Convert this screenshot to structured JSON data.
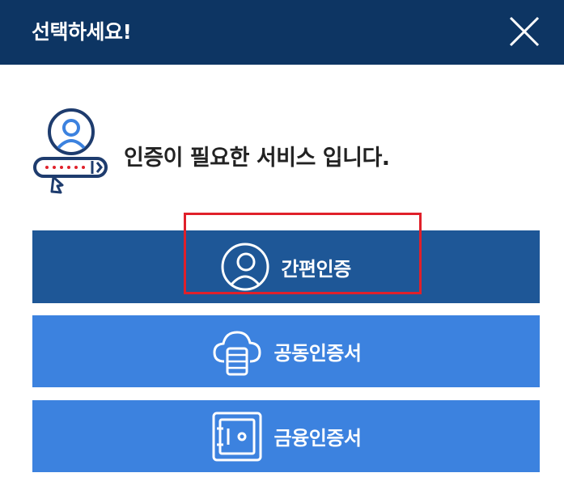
{
  "header": {
    "title": "선택하세요!",
    "close_icon": "close-x-icon"
  },
  "auth_notice": {
    "icon": "user-password-icon",
    "message": "인증이 필요한 서비스 입니다."
  },
  "buttons": [
    {
      "label": "간편인증",
      "icon": "user-circle-icon"
    },
    {
      "label": "공동인증서",
      "icon": "cloud-database-icon"
    },
    {
      "label": "금융인증서",
      "icon": "safe-vault-icon"
    }
  ],
  "colors": {
    "header_bg": "#0d3563",
    "simple_auth_bg": "#1e5797",
    "certificate_bg": "#3c82df",
    "highlight": "#e0202a"
  }
}
